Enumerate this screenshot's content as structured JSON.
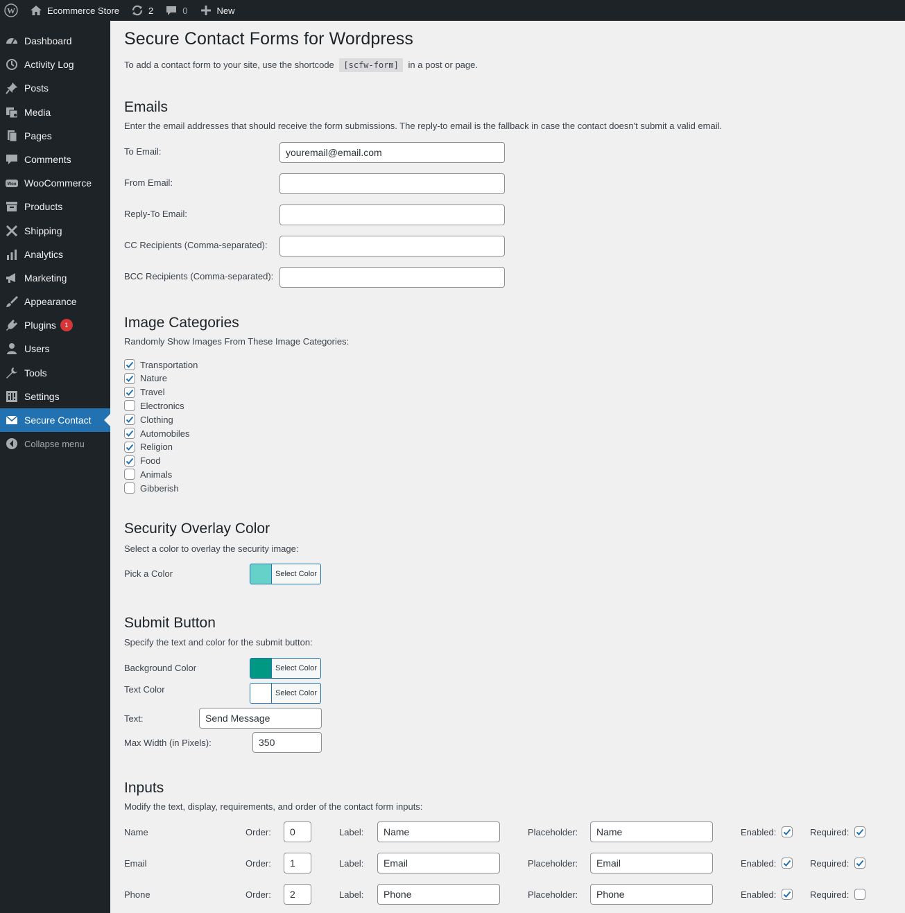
{
  "adminbar": {
    "site_name": "Ecommerce Store",
    "updates_count": "2",
    "comments_count": "0",
    "new_label": "New"
  },
  "sidebar": {
    "items": [
      {
        "label": "Dashboard",
        "icon": "dashboard-icon"
      },
      {
        "label": "Activity Log",
        "icon": "history-icon"
      },
      {
        "label": "Posts",
        "icon": "pin-icon"
      },
      {
        "label": "Media",
        "icon": "media-icon"
      },
      {
        "label": "Pages",
        "icon": "pages-icon"
      },
      {
        "label": "Comments",
        "icon": "comment-icon"
      },
      {
        "label": "WooCommerce",
        "icon": "woo-icon"
      },
      {
        "label": "Products",
        "icon": "archive-icon"
      },
      {
        "label": "Shipping",
        "icon": "shipping-icon"
      },
      {
        "label": "Analytics",
        "icon": "chart-icon"
      },
      {
        "label": "Marketing",
        "icon": "megaphone-icon"
      },
      {
        "label": "Appearance",
        "icon": "brush-icon"
      },
      {
        "label": "Plugins",
        "icon": "plugin-icon",
        "badge": "1"
      },
      {
        "label": "Users",
        "icon": "user-icon"
      },
      {
        "label": "Tools",
        "icon": "wrench-icon"
      },
      {
        "label": "Settings",
        "icon": "settings-icon"
      },
      {
        "label": "Secure Contact",
        "icon": "email-icon"
      },
      {
        "label": "Collapse menu",
        "icon": "collapse-icon"
      }
    ]
  },
  "page": {
    "title": "Secure Contact Forms for Wordpress",
    "intro_before": "To add a contact form to your site, use the shortcode",
    "shortcode": "[scfw-form]",
    "intro_after": "in a post or page."
  },
  "emails": {
    "heading": "Emails",
    "description": "Enter the email addresses that should receive the form submissions. The reply-to email is the fallback in case the contact doesn't submit a valid email.",
    "fields": [
      {
        "label": "To Email:",
        "value": "youremail@email.com"
      },
      {
        "label": "From Email:",
        "value": ""
      },
      {
        "label": "Reply-To Email:",
        "value": ""
      },
      {
        "label": "CC Recipients (Comma-separated):",
        "value": ""
      },
      {
        "label": "BCC Recipients (Comma-separated):",
        "value": ""
      }
    ]
  },
  "categories": {
    "heading": "Image Categories",
    "description": "Randomly Show Images From These Image Categories:",
    "items": [
      {
        "label": "Transportation",
        "checked": true
      },
      {
        "label": "Nature",
        "checked": true
      },
      {
        "label": "Travel",
        "checked": true
      },
      {
        "label": "Electronics",
        "checked": false
      },
      {
        "label": "Clothing",
        "checked": true
      },
      {
        "label": "Automobiles",
        "checked": true
      },
      {
        "label": "Religion",
        "checked": true
      },
      {
        "label": "Food",
        "checked": true
      },
      {
        "label": "Animals",
        "checked": false
      },
      {
        "label": "Gibberish",
        "checked": false
      }
    ]
  },
  "overlay": {
    "heading": "Security Overlay Color",
    "description": "Select a color to overlay the security image:",
    "pick_label": "Pick a Color",
    "button_label": "Select Color",
    "color": "#66d1c9"
  },
  "submit": {
    "heading": "Submit Button",
    "description": "Specify the text and color for the submit button:",
    "bg_label": "Background Color",
    "bg_color": "#009883",
    "text_color_label": "Text Color",
    "text_color": "#ffffff",
    "button_label": "Select Color",
    "text_label": "Text:",
    "text_value": "Send Message",
    "width_label": "Max Width (in Pixels):",
    "width_value": "350"
  },
  "inputs": {
    "heading": "Inputs",
    "description": "Modify the text, display, requirements, and order of the contact form inputs:",
    "order_label": "Order:",
    "label_label": "Label:",
    "placeholder_label": "Placeholder:",
    "enabled_label": "Enabled:",
    "required_label": "Required:",
    "rows": [
      {
        "name": "Name",
        "order": "0",
        "label": "Name",
        "placeholder": "Name",
        "enabled": true,
        "required": true
      },
      {
        "name": "Email",
        "order": "1",
        "label": "Email",
        "placeholder": "Email",
        "enabled": true,
        "required": true
      },
      {
        "name": "Phone",
        "order": "2",
        "label": "Phone",
        "placeholder": "Phone",
        "enabled": true,
        "required": false
      }
    ]
  }
}
